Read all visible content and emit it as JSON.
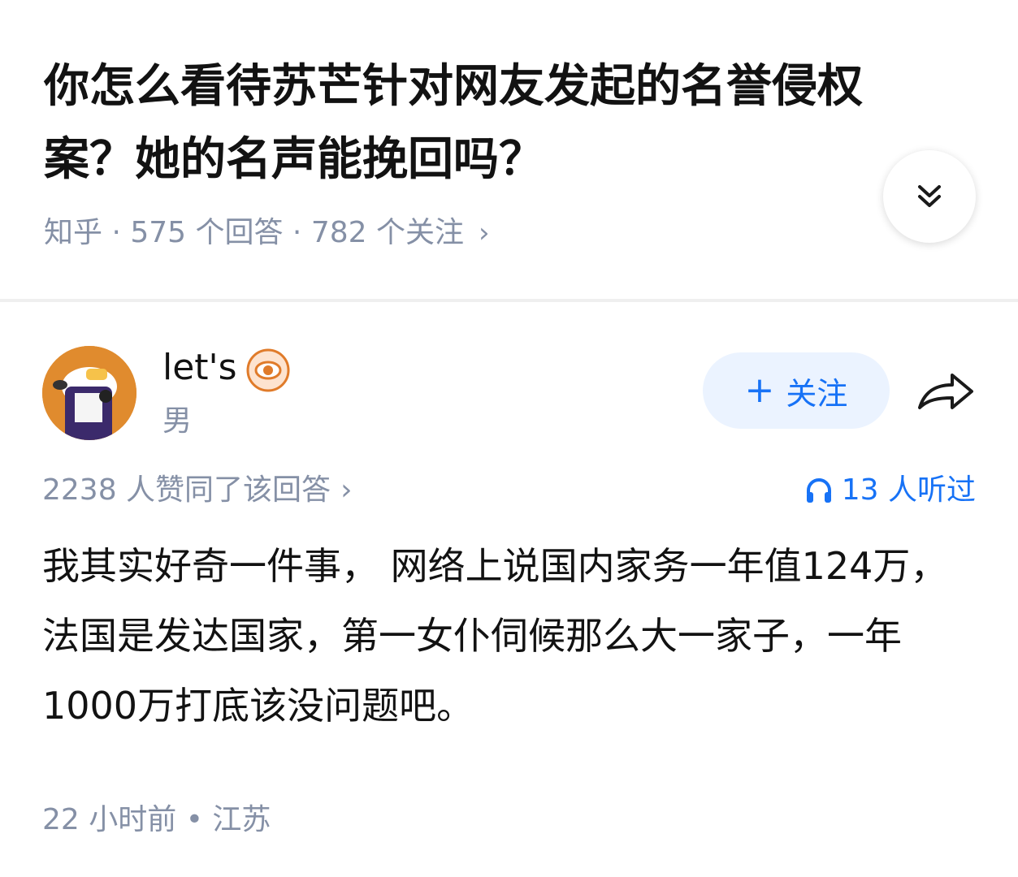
{
  "question": {
    "title": "你怎么看待苏芒针对网友发起的名誉侵权案？她的名声能挽回吗？",
    "meta": "知乎 · 575 个回答 · 782 个关注",
    "meta_chevron": "›"
  },
  "expand_icon": "double-chevron-down-icon",
  "author": {
    "name": "let's",
    "gender": "男",
    "badge_icon": "eye-badge-icon",
    "avatar_colors": {
      "bg": "#e08b2e",
      "body": "#3b2a6b",
      "face": "#ffffff"
    }
  },
  "follow_button": {
    "plus": "+",
    "label": "关注"
  },
  "share_icon": "share-arrow-icon",
  "answer": {
    "votes": "2238 人赞同了该回答",
    "votes_chevron": "›",
    "listeners": "13 人听过",
    "body": "我其实好奇一件事， 网络上说国内家务一年值124万，法国是发达国家，第一女仆伺候那么大一家子，一年1000万打底该没问题吧。",
    "footer": "22 小时前 • 江苏"
  },
  "colors": {
    "accent": "#1772f6",
    "muted": "#8590a6",
    "follow_bg": "#ebf3ff",
    "badge": "#e07b2a"
  }
}
